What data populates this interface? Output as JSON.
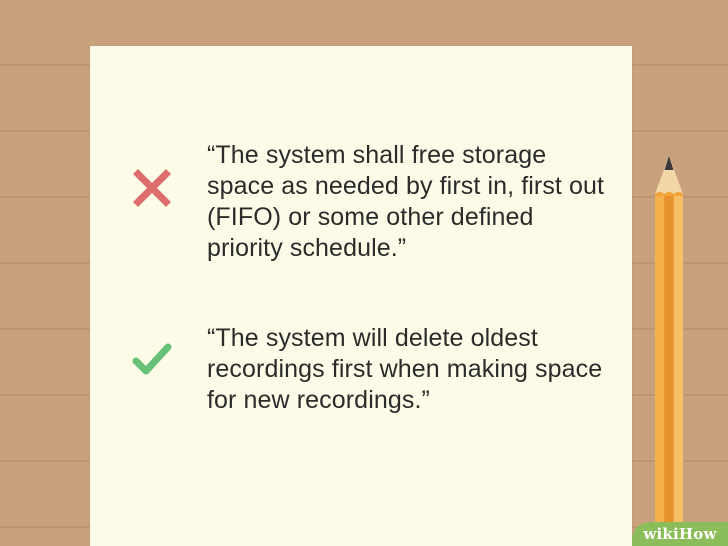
{
  "examples": [
    {
      "verdict": "bad",
      "icon": "cross-icon",
      "color": "#de6e6e",
      "text": "“The system shall free storage space as needed by first in, first out (FIFO) or some other defined priority schedule.”"
    },
    {
      "verdict": "good",
      "icon": "checkmark-icon",
      "color": "#68c178",
      "text": "“The system will delete oldest recordings first when making space for new recordings.”"
    }
  ],
  "watermark": {
    "part1": "wiki",
    "part2": "How"
  },
  "colors": {
    "desk": "#c8a27c",
    "paper": "#fcfbe8",
    "pencil_body": "#f2a33a",
    "watermark_bg": "#8bbd5a"
  }
}
